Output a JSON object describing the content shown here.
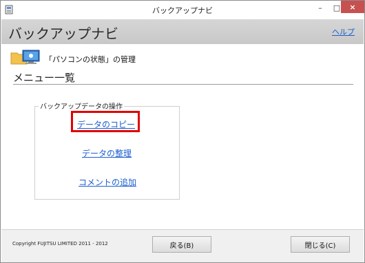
{
  "window": {
    "title": "バックアップナビ",
    "controls": {
      "minimize": "–",
      "maximize": "□",
      "close": "×"
    }
  },
  "header": {
    "app_title": "バックアップナビ",
    "help_link": "ヘルプ"
  },
  "status": {
    "label": "「パソコンの状態」の管理",
    "icon": "pc-folder-icon"
  },
  "main": {
    "section_title": "メニュー一覧",
    "group": {
      "legend": "バックアップデータの操作",
      "links": [
        {
          "label": "データのコピー",
          "highlighted": true
        },
        {
          "label": "データの整理"
        },
        {
          "label": "コメントの追加"
        }
      ]
    }
  },
  "footer": {
    "copyright": "Copyright FUJITSU LIMITED 2011 - 2012",
    "back_button": "戻る(B)",
    "close_button": "閉じる(C)"
  },
  "colors": {
    "link": "#1a5fd0",
    "highlight_border": "#e00000",
    "header_band": "#cccccc",
    "close_button": "#c75050"
  }
}
